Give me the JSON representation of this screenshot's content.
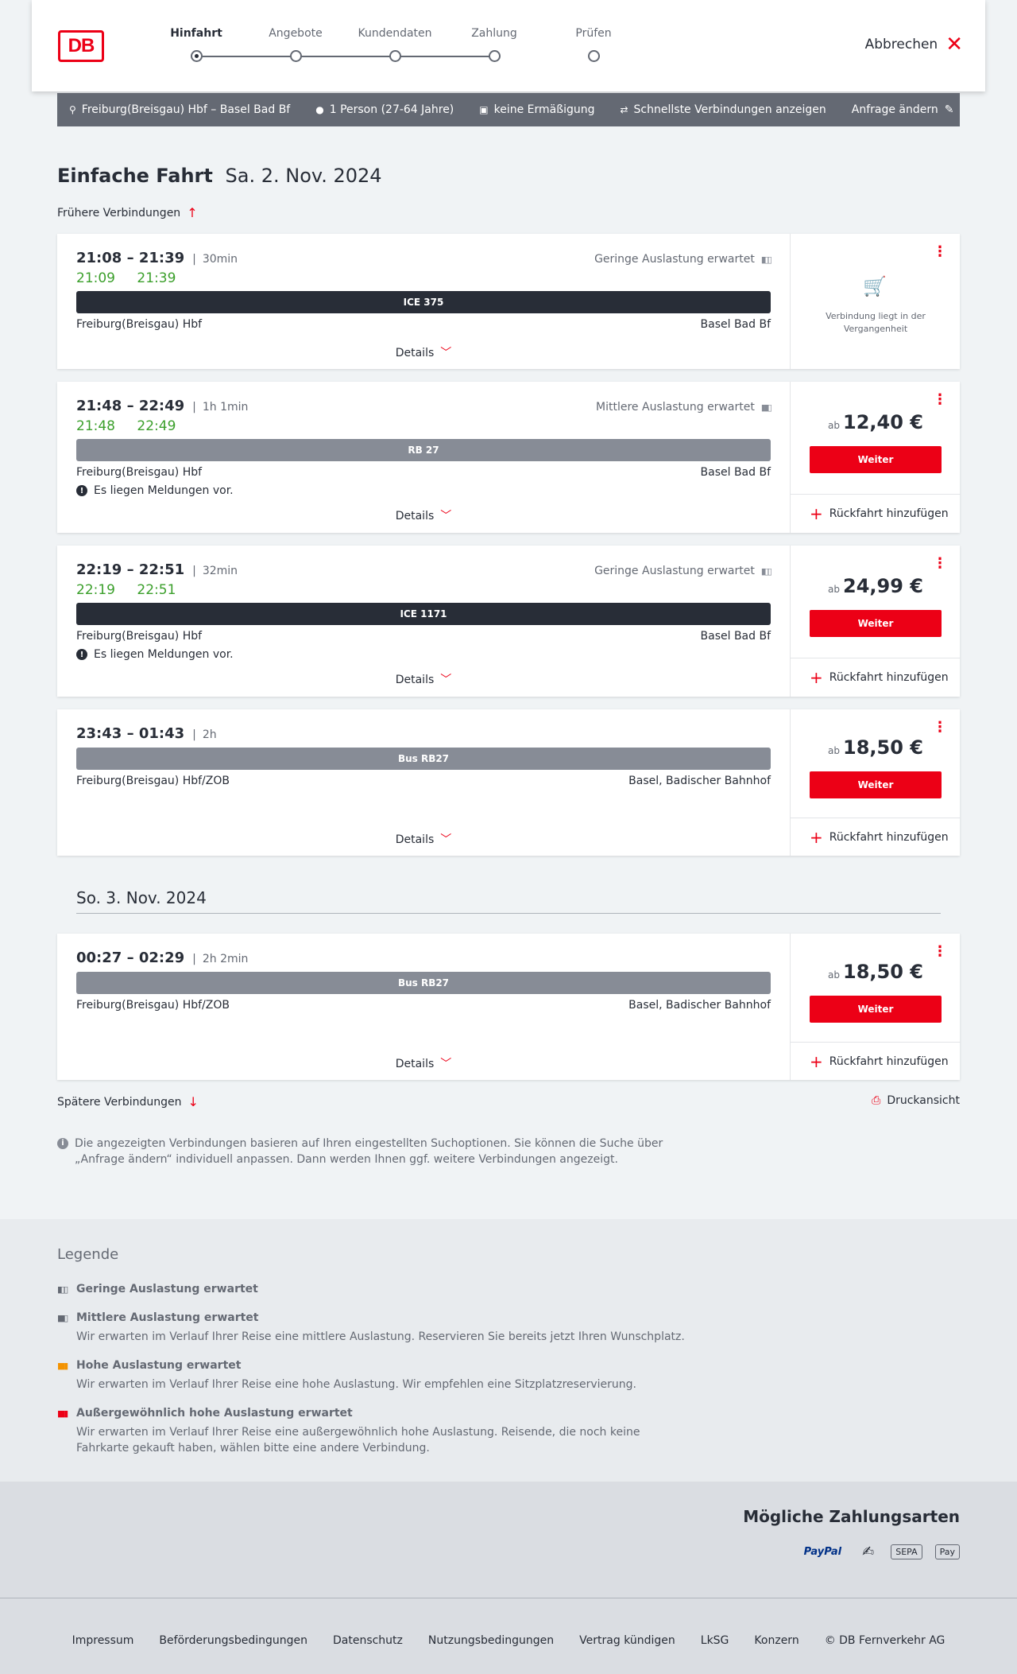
{
  "header": {
    "steps": [
      "Hinfahrt",
      "Angebote",
      "Kundendaten",
      "Zahlung",
      "Prüfen"
    ],
    "logo_text": "DB",
    "cancel_label": "Abbrechen"
  },
  "searchbar": {
    "route": "Freiburg(Breisgau) Hbf – Basel Bad Bf",
    "travellers": "1 Person (27-64 Jahre)",
    "discount": "keine Ermäßigung",
    "fastest": "Schnellste Verbindungen anzeigen",
    "edit": "Anfrage ändern"
  },
  "title": {
    "bold": "Einfache Fahrt",
    "date": "Sa. 2. Nov. 2024"
  },
  "earlier_label": "Frühere Verbindungen",
  "details_label": "Details",
  "weiter_label": "Weiter",
  "return_label": "Rückfahrt hinzufügen",
  "ab_label": "ab",
  "message_label": "Es liegen Meldungen vor.",
  "past_label": "Verbindung liegt in der Vergangenheit",
  "connections": [
    {
      "times": "21:08 – 21:39",
      "duration": "30min",
      "rt_dep": "21:09",
      "rt_arr": "21:39",
      "load": "Geringe Auslastung erwartet",
      "train": "ICE 375",
      "from": "Freiburg(Breisgau) Hbf",
      "to": "Basel Bad Bf"
    },
    {
      "times": "21:48 – 22:49",
      "duration": "1h 1min",
      "rt_dep": "21:48",
      "rt_arr": "22:49",
      "load": "Mittlere Auslastung erwartet",
      "train": "RB 27",
      "from": "Freiburg(Breisgau) Hbf",
      "to": "Basel Bad Bf",
      "price": "12,40 €"
    },
    {
      "times": "22:19 – 22:51",
      "duration": "32min",
      "rt_dep": "22:19",
      "rt_arr": "22:51",
      "load": "Geringe Auslastung erwartet",
      "train": "ICE 1171",
      "from": "Freiburg(Breisgau) Hbf",
      "to": "Basel Bad Bf",
      "price": "24,99 €"
    },
    {
      "times": "23:43 – 01:43",
      "duration": "2h",
      "train": "Bus RB27",
      "from": "Freiburg(Breisgau) Hbf/ZOB",
      "to": "Basel, Badischer Bahnhof",
      "price": "18,50 €"
    },
    {
      "times": "00:27 – 02:29",
      "duration": "2h 2min",
      "train": "Bus RB27",
      "from": "Freiburg(Breisgau) Hbf/ZOB",
      "to": "Basel, Badischer Bahnhof",
      "price": "18,50 €"
    }
  ],
  "next_day_heading": "So. 3. Nov. 2024",
  "later_label": "Spätere Verbindungen",
  "print_label": "Druckansicht",
  "info_text": "Die angezeigten Verbindungen basieren auf Ihren eingestellten Suchoptionen. Sie können die Suche über „Anfrage ändern“ individuell anpassen. Dann werden Ihnen ggf. weitere Verbindungen angezeigt.",
  "legend": {
    "title": "Legende",
    "items": [
      {
        "label": "Geringe Auslastung erwartet",
        "desc": "",
        "color": "#646973"
      },
      {
        "label": "Mittlere Auslastung erwartet",
        "desc": "Wir erwarten im Verlauf Ihrer Reise eine mittlere Auslastung. Reservieren Sie bereits jetzt Ihren Wunschplatz.",
        "color": "#646973"
      },
      {
        "label": "Hohe Auslastung erwartet",
        "desc": "Wir erwarten im Verlauf Ihrer Reise eine hohe Auslastung. Wir empfehlen eine Sitzplatzreservierung.",
        "color": "#f39200"
      },
      {
        "label": "Außergewöhnlich hohe Auslastung erwartet",
        "desc": "Wir erwarten im Verlauf Ihrer Reise eine außergewöhnlich hohe Auslastung. Reisende, die noch keine Fahrkarte gekauft haben, wählen bitte eine andere Verbindung.",
        "color": "#ec0016"
      }
    ]
  },
  "payment": {
    "title": "Mögliche Zahlungsarten",
    "methods": [
      "PayPal",
      "✍",
      "SEPA",
      " Pay"
    ]
  },
  "footer": {
    "links": [
      "Impressum",
      "Beförderungsbedingungen",
      "Datenschutz",
      "Nutzungsbedingungen",
      "Vertrag kündigen",
      "LkSG",
      "Konzern",
      "© DB Fernverkehr AG"
    ]
  }
}
